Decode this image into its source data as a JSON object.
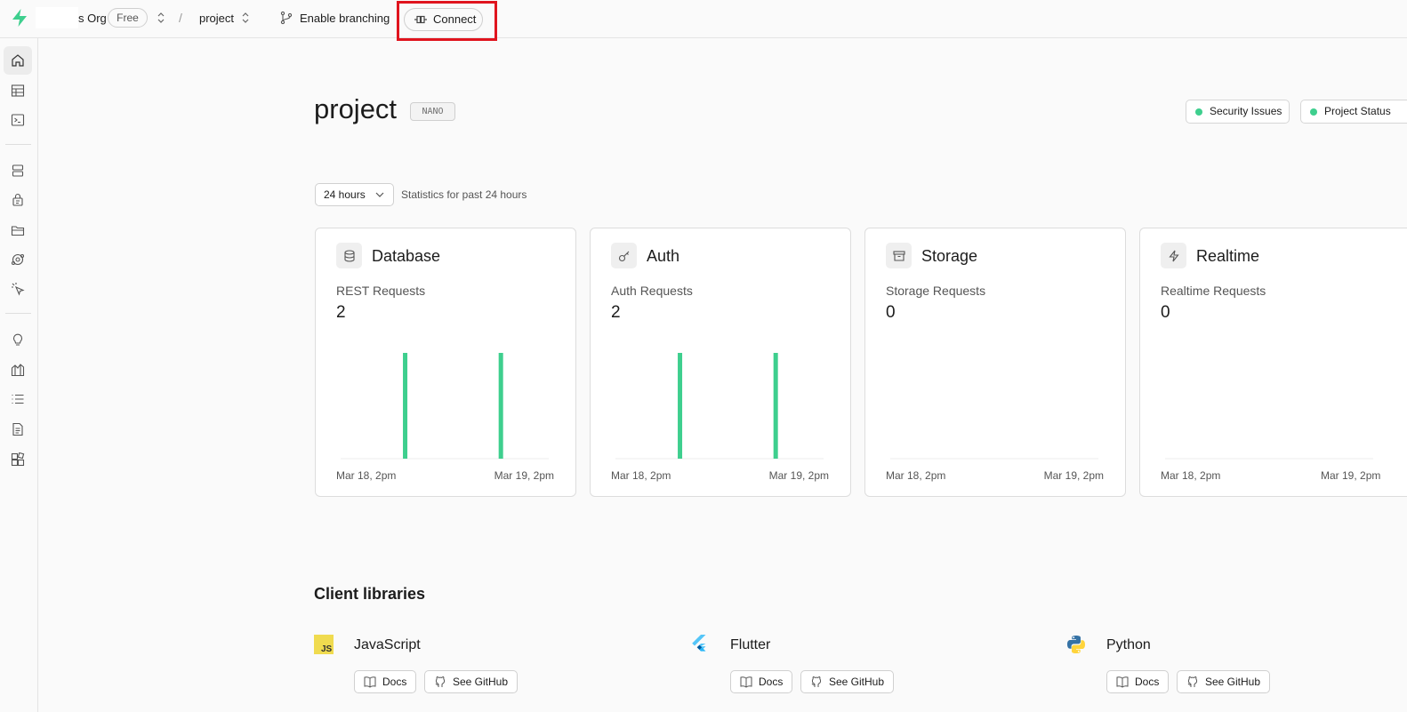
{
  "topbar": {
    "org_name": "s Org",
    "plan_badge": "Free",
    "separator": "/",
    "project_name": "project",
    "branching_label": "Enable branching",
    "connect_label": "Connect"
  },
  "sidebar": {
    "icons": [
      "home-icon",
      "table-editor-icon",
      "sql-editor-icon",
      "database-icon",
      "auth-icon",
      "storage-icon",
      "edge-functions-icon",
      "realtime-icon",
      "advisors-icon",
      "reports-icon",
      "logs-icon",
      "api-docs-icon",
      "integrations-icon"
    ],
    "active_item": "home-icon"
  },
  "header": {
    "title": "project",
    "compute_badge": "NANO",
    "security_label": "Security Issues",
    "status_label": "Project Status",
    "status_color": "#3ecf8e"
  },
  "stats": {
    "range_value": "24 hours",
    "caption": "Statistics for past 24 hours"
  },
  "cards": [
    {
      "title": "Database",
      "icon": "database-icon",
      "metric_label": "REST Requests",
      "metric_value": "2",
      "date_start": "Mar 18, 2pm",
      "date_end": "Mar 19, 2pm"
    },
    {
      "title": "Auth",
      "icon": "key-icon",
      "metric_label": "Auth Requests",
      "metric_value": "2",
      "date_start": "Mar 18, 2pm",
      "date_end": "Mar 19, 2pm"
    },
    {
      "title": "Storage",
      "icon": "archive-icon",
      "metric_label": "Storage Requests",
      "metric_value": "0",
      "date_start": "Mar 18, 2pm",
      "date_end": "Mar 19, 2pm"
    },
    {
      "title": "Realtime",
      "icon": "zap-icon",
      "metric_label": "Realtime Requests",
      "metric_value": "0",
      "date_start": "Mar 18, 2pm",
      "date_end": "Mar 19, 2pm"
    }
  ],
  "chart_data": [
    {
      "type": "bar",
      "title": "REST Requests",
      "x_start": "Mar 18, 2pm",
      "x_end": "Mar 19, 2pm",
      "bar_positions": [
        0.31,
        0.77
      ],
      "values": [
        1,
        1
      ],
      "ylim": [
        0,
        1
      ],
      "color": "#3ecf8e"
    },
    {
      "type": "bar",
      "title": "Auth Requests",
      "x_start": "Mar 18, 2pm",
      "x_end": "Mar 19, 2pm",
      "bar_positions": [
        0.31,
        0.77
      ],
      "values": [
        1,
        1
      ],
      "ylim": [
        0,
        1
      ],
      "color": "#3ecf8e"
    },
    {
      "type": "bar",
      "title": "Storage Requests",
      "x_start": "Mar 18, 2pm",
      "x_end": "Mar 19, 2pm",
      "bar_positions": [],
      "values": [],
      "ylim": [
        0,
        1
      ],
      "color": "#3ecf8e"
    },
    {
      "type": "bar",
      "title": "Realtime Requests",
      "x_start": "Mar 18, 2pm",
      "x_end": "Mar 19, 2pm",
      "bar_positions": [],
      "values": [],
      "ylim": [
        0,
        1
      ],
      "color": "#3ecf8e"
    }
  ],
  "client_libraries": {
    "title": "Client libraries",
    "items": [
      {
        "name": "JavaScript",
        "icon": "javascript-logo-icon",
        "docs_label": "Docs",
        "github_label": "See GitHub"
      },
      {
        "name": "Flutter",
        "icon": "flutter-logo-icon",
        "docs_label": "Docs",
        "github_label": "See GitHub"
      },
      {
        "name": "Python",
        "icon": "python-logo-icon",
        "docs_label": "Docs",
        "github_label": "See GitHub"
      }
    ]
  }
}
